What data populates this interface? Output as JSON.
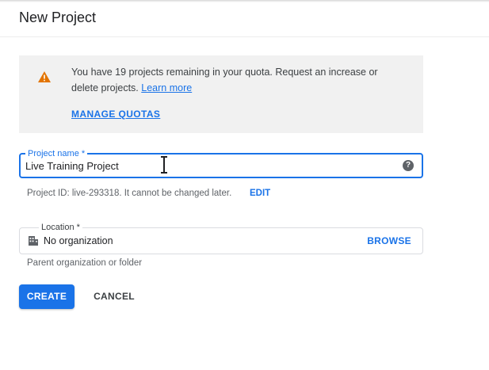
{
  "page": {
    "title": "New Project"
  },
  "quota": {
    "message": "You have 19 projects remaining in your quota. Request an increase or delete projects.",
    "learn_more": "Learn more",
    "manage_quotas": "MANAGE QUOTAS",
    "icon": "warning-icon",
    "icon_color": "#e37400"
  },
  "project_name": {
    "label": "Project name *",
    "value": "Live Training Project",
    "help_icon": "help-icon"
  },
  "project_id": {
    "text": "Project ID: live-293318. It cannot be changed later.",
    "edit": "EDIT"
  },
  "location": {
    "label": "Location *",
    "value": "No organization",
    "browse": "BROWSE",
    "helper": "Parent organization or folder",
    "icon": "building-icon"
  },
  "actions": {
    "create": "CREATE",
    "cancel": "CANCEL"
  },
  "colors": {
    "accent": "#1a73e8",
    "panel": "#f1f1f1"
  }
}
